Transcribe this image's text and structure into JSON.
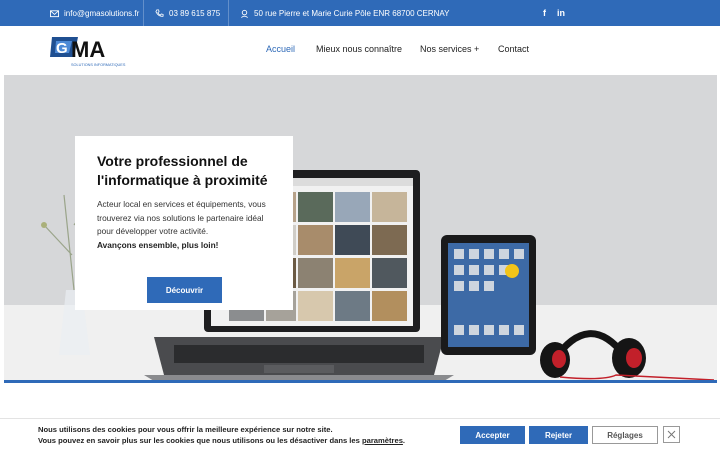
{
  "topbar": {
    "email": "info@gmasolutions.fr",
    "phone": "03 89 615 875",
    "address": "50 rue Pierre et Marie Curie Pôle ENR 68700 CERNAY",
    "social": [
      "f",
      "in"
    ]
  },
  "logo": {
    "text": "GMA",
    "tagline": "SOLUTIONS INFORMATIQUES"
  },
  "nav": [
    {
      "label": "Accueil",
      "active": true
    },
    {
      "label": "Mieux nous connaître",
      "active": false
    },
    {
      "label": "Nos services +",
      "active": false
    },
    {
      "label": "Contact",
      "active": false
    }
  ],
  "hero": {
    "title": "Votre professionnel de l'informatique à proximité",
    "body": "Acteur local en services et équipements, vous trouverez via nos solutions le partenaire idéal pour développer votre activité.",
    "tagline": "Avançons ensemble, plus loin!",
    "cta": "Découvrir"
  },
  "cookie": {
    "line1": "Nous utilisons des cookies pour vous offrir la meilleure expérience sur notre site.",
    "line2_prefix": "Vous pouvez en savoir plus sur les cookies que nous utilisons ou les désactiver dans les ",
    "line2_link": "paramètres",
    "line2_suffix": ".",
    "accept": "Accepter",
    "reject": "Rejeter",
    "settings": "Réglages"
  },
  "colors": {
    "brand": "#2f6ab8",
    "text": "#222222"
  },
  "icons": [
    "mail-icon",
    "phone-icon",
    "location-icon",
    "facebook-icon",
    "linkedin-icon",
    "close-icon"
  ]
}
